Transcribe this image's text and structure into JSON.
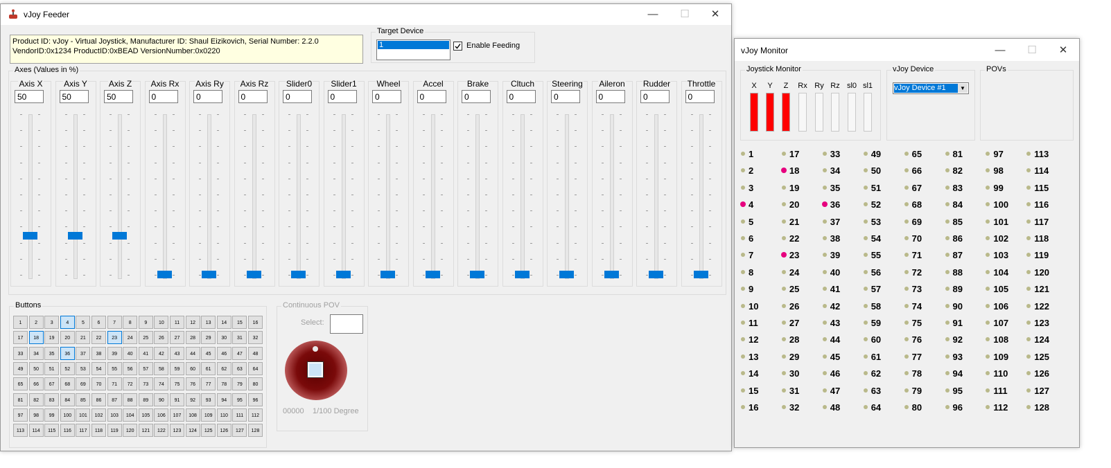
{
  "feeder": {
    "title": "vJoy Feeder",
    "info_line1": "Product ID: vJoy - Virtual Joystick, Manufacturer ID: Shaul Eizikovich, Serial Number: 2.2.0",
    "info_line2": "VendorID:0x1234 ProductID:0xBEAD VersionNumber:0x0220",
    "target_device_label": "Target Device",
    "target_device_value": "1",
    "enable_feeding_label": "Enable Feeding",
    "enable_feeding_checked": true,
    "axes_group_label": "Axes (Values in %)",
    "axes": [
      {
        "name": "Axis X",
        "value": "50",
        "level": 50
      },
      {
        "name": "Axis Y",
        "value": "50",
        "level": 50
      },
      {
        "name": "Axis Z",
        "value": "50",
        "level": 50
      },
      {
        "name": "Axis Rx",
        "value": "0",
        "level": 0
      },
      {
        "name": "Axis Ry",
        "value": "0",
        "level": 0
      },
      {
        "name": "Axis Rz",
        "value": "0",
        "level": 0
      },
      {
        "name": "Slider0",
        "value": "0",
        "level": 0
      },
      {
        "name": "Slider1",
        "value": "0",
        "level": 0
      },
      {
        "name": "Wheel",
        "value": "0",
        "level": 0
      },
      {
        "name": "Accel",
        "value": "0",
        "level": 0
      },
      {
        "name": "Brake",
        "value": "0",
        "level": 0
      },
      {
        "name": "Cltuch",
        "value": "0",
        "level": 0
      },
      {
        "name": "Steering",
        "value": "0",
        "level": 0
      },
      {
        "name": "Aileron",
        "value": "0",
        "level": 0
      },
      {
        "name": "Rudder",
        "value": "0",
        "level": 0
      },
      {
        "name": "Throttle",
        "value": "0",
        "level": 0
      }
    ],
    "buttons_group_label": "Buttons",
    "pressed_buttons": [
      4,
      18,
      23,
      36
    ],
    "pov_group_label": "Continuous POV",
    "pov_select_label": "Select:",
    "pov_value": "00000",
    "pov_unit": "1/100 Degree"
  },
  "monitor": {
    "title": "vJoy Monitor",
    "joystick_monitor_label": "Joystick Monitor",
    "bar_labels": [
      "X",
      "Y",
      "Z",
      "Rx",
      "Ry",
      "Rz",
      "sl0",
      "sl1"
    ],
    "bar_levels": [
      100,
      100,
      100,
      0,
      0,
      0,
      0,
      0
    ],
    "vjoy_device_label": "vJoy Device",
    "vjoy_device_value": "vJoy Device #1",
    "povs_label": "POVs",
    "pressed_buttons": [
      4,
      18,
      23,
      36
    ]
  },
  "colors": {
    "accent": "#0078d7",
    "pressed_dot": "#e6007e",
    "bar_fill": "#ff0000",
    "info_bg": "#ffffe1"
  }
}
